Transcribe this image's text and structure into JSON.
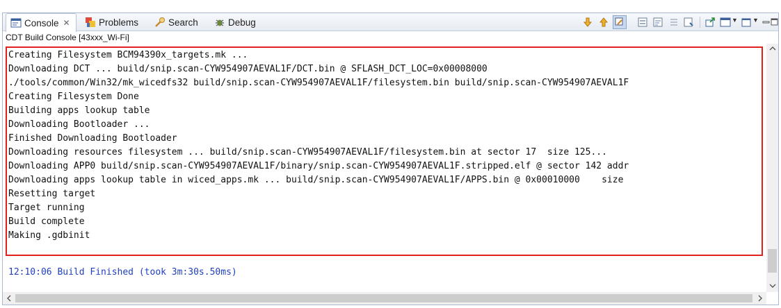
{
  "tabs": [
    {
      "label": "Console",
      "icon": "console-icon",
      "active": true
    },
    {
      "label": "Problems",
      "icon": "problems-icon"
    },
    {
      "label": "Search",
      "icon": "search-icon"
    },
    {
      "label": "Debug",
      "icon": "debug-icon"
    }
  ],
  "tab_close_glyph": "✕",
  "console_name": "CDT Build Console [43xxx_Wi-Fi]",
  "output_lines": [
    "Creating Filesystem BCM94390x_targets.mk ...",
    "Downloading DCT ... build/snip.scan-CYW954907AEVAL1F/DCT.bin @ SFLASH_DCT_LOC=0x00008000",
    "./tools/common/Win32/mk_wicedfs32 build/snip.scan-CYW954907AEVAL1F/filesystem.bin build/snip.scan-CYW954907AEVAL1F",
    "Creating Filesystem Done",
    "Building apps lookup table",
    "Downloading Bootloader ...",
    "Finished Downloading Bootloader",
    "Downloading resources filesystem ... build/snip.scan-CYW954907AEVAL1F/filesystem.bin at sector 17  size 125...",
    "Downloading APP0 build/snip.scan-CYW954907AEVAL1F/binary/snip.scan-CYW954907AEVAL1F.stripped.elf @ sector 142 addr",
    "Downloading apps lookup table in wiced_apps.mk ... build/snip.scan-CYW954907AEVAL1F/APPS.bin @ 0x00010000    size",
    "Resetting target",
    "Target running",
    "Build complete",
    "Making .gdbinit"
  ],
  "build_finished": "12:10:06 Build Finished (took 3m:30s.50ms)",
  "colors": {
    "highlight_border": "#e0201f",
    "finished_text": "#1f3fbf"
  }
}
